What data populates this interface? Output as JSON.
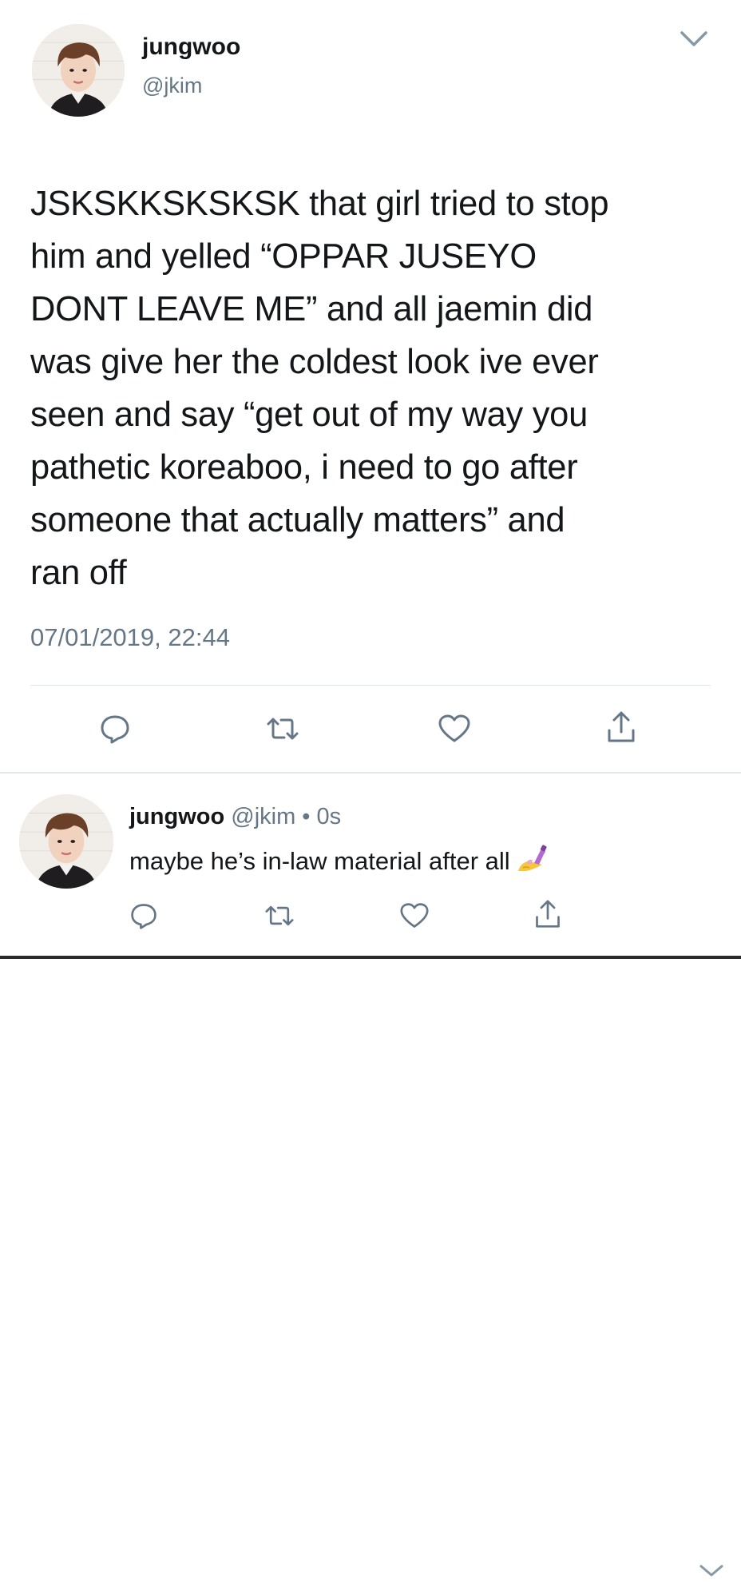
{
  "main_tweet": {
    "display_name": "jungwoo",
    "handle": "@jkim",
    "text_lines": [
      "JSKSKKSKSKSK that girl tried to stop",
      "him and yelled “OPPAR JUSEYO",
      "DONT LEAVE ME” and all jaemin did",
      "was give her the coldest look ive ever",
      "seen and say “get out of my way you",
      "pathetic koreaboo, i need to go after",
      "someone that actually matters” and",
      "ran off"
    ],
    "timestamp": "07/01/2019, 22:44",
    "actions": [
      "reply-icon",
      "retweet-icon",
      "like-icon",
      "share-icon"
    ]
  },
  "reply_tweet": {
    "display_name": "jungwoo",
    "handle": "@jkim",
    "separator": "•",
    "time": "0s",
    "text": "maybe he’s in-law material after all",
    "emoji": "nail-polish-icon",
    "actions": [
      "reply-icon",
      "retweet-icon",
      "like-icon",
      "share-icon"
    ]
  },
  "colors": {
    "text": "#14171a",
    "secondary": "#657786",
    "divider": "#e1e8ed",
    "icon": "#657786"
  }
}
